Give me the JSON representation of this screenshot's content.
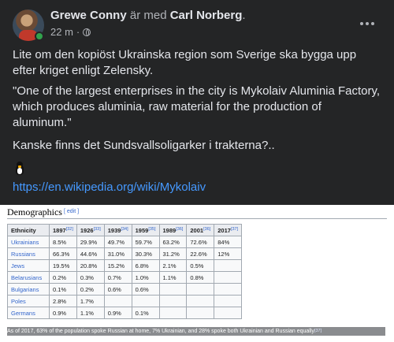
{
  "post": {
    "author": "Grewe Conny",
    "connector": " är med ",
    "tagged": "Carl Norberg",
    "period": ".",
    "time": "22 m",
    "dot": "·",
    "paragraphs": [
      "Lite om den kopiöst Ukrainska region som Sverige ska bygga upp efter kriget enligt Zelensky.",
      "\"One of the largest enterprises in the city is Mykolaiv Aluminia Factory, which produces aluminia, raw material for the production of aluminum.\"",
      "Kanske finns det Sundsvallsoligarker i trakterna?.."
    ],
    "link": "https://en.wikipedia.org/wiki/Mykolaiv",
    "icons": {
      "avatar": "profile-photo",
      "privacy": "globe-icon",
      "more": "more-options-icon",
      "emoji": "penguin-emoji"
    }
  },
  "wiki": {
    "heading": "Demographics",
    "edit": "[ edit ]",
    "columns": [
      {
        "label": "Ethnicity",
        "ref": ""
      },
      {
        "label": "1897",
        "ref": "[32]"
      },
      {
        "label": "1926",
        "ref": "[33]"
      },
      {
        "label": "1939",
        "ref": "[34]"
      },
      {
        "label": "1959",
        "ref": "[35]"
      },
      {
        "label": "1989",
        "ref": "[36]"
      },
      {
        "label": "2001",
        "ref": "[36]"
      },
      {
        "label": "2017",
        "ref": "[37]"
      }
    ],
    "rows": [
      [
        "Ukrainians",
        "8.5%",
        "29.9%",
        "49.7%",
        "59.7%",
        "63.2%",
        "72.6%",
        "84%"
      ],
      [
        "Russians",
        "66.3%",
        "44.6%",
        "31.0%",
        "30.3%",
        "31.2%",
        "22.6%",
        "12%"
      ],
      [
        "Jews",
        "19.5%",
        "20.8%",
        "15.2%",
        "6.8%",
        "2.1%",
        "0.5%",
        ""
      ],
      [
        "Belarusians",
        "0.2%",
        "0.3%",
        "0.7%",
        "1.0%",
        "1.1%",
        "0.8%",
        ""
      ],
      [
        "Bulgarians",
        "0.1%",
        "0.2%",
        "0.6%",
        "0.6%",
        "",
        "",
        ""
      ],
      [
        "Poles",
        "2.8%",
        "1.7%",
        "",
        "",
        "",
        "",
        ""
      ],
      [
        "Germans",
        "0.9%",
        "1.1%",
        "0.9%",
        "0.1%",
        "",
        "",
        ""
      ]
    ],
    "footnote": "As of 2017, 63% of the population spoke Russian at home, 7% Ukrainian, and 28% spoke both Ukrainian and Russian equally",
    "footnote_ref": "[37]"
  }
}
